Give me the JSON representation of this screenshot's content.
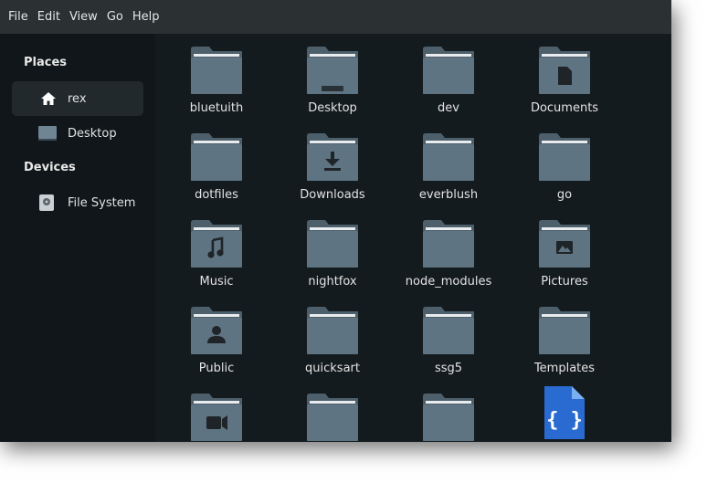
{
  "menubar": {
    "items": [
      "File",
      "Edit",
      "View",
      "Go",
      "Help"
    ]
  },
  "sidebar": {
    "places_title": "Places",
    "devices_title": "Devices",
    "places": [
      {
        "label": "rex",
        "icon": "home-icon",
        "active": true
      },
      {
        "label": "Desktop",
        "icon": "desktop-icon",
        "active": false
      }
    ],
    "devices": [
      {
        "label": "File System",
        "icon": "drive-icon",
        "active": false
      }
    ]
  },
  "files": [
    {
      "name": "bluetuith",
      "icon": "folder-icon"
    },
    {
      "name": "Desktop",
      "icon": "desktop-folder-icon"
    },
    {
      "name": "dev",
      "icon": "folder-icon"
    },
    {
      "name": "Documents",
      "icon": "documents-folder-icon"
    },
    {
      "name": "dotfiles",
      "icon": "folder-icon"
    },
    {
      "name": "Downloads",
      "icon": "downloads-folder-icon"
    },
    {
      "name": "everblush",
      "icon": "folder-icon"
    },
    {
      "name": "go",
      "icon": "folder-icon"
    },
    {
      "name": "Music",
      "icon": "music-folder-icon"
    },
    {
      "name": "nightfox",
      "icon": "folder-icon"
    },
    {
      "name": "node_modules",
      "icon": "folder-icon"
    },
    {
      "name": "Pictures",
      "icon": "pictures-folder-icon"
    },
    {
      "name": "Public",
      "icon": "public-folder-icon"
    },
    {
      "name": "quicksart",
      "icon": "folder-icon"
    },
    {
      "name": "ssg5",
      "icon": "folder-icon"
    },
    {
      "name": "Templates",
      "icon": "folder-icon"
    },
    {
      "name": "",
      "icon": "videos-folder-icon"
    },
    {
      "name": "",
      "icon": "folder-icon"
    },
    {
      "name": "",
      "icon": "folder-icon"
    },
    {
      "name": "",
      "icon": "json-file-icon"
    }
  ],
  "colors": {
    "folder": "#5f7482",
    "folder_tab": "#4d5f6b",
    "folder_stripe": "#e9ecee",
    "json_file": "#2a6bd1"
  }
}
